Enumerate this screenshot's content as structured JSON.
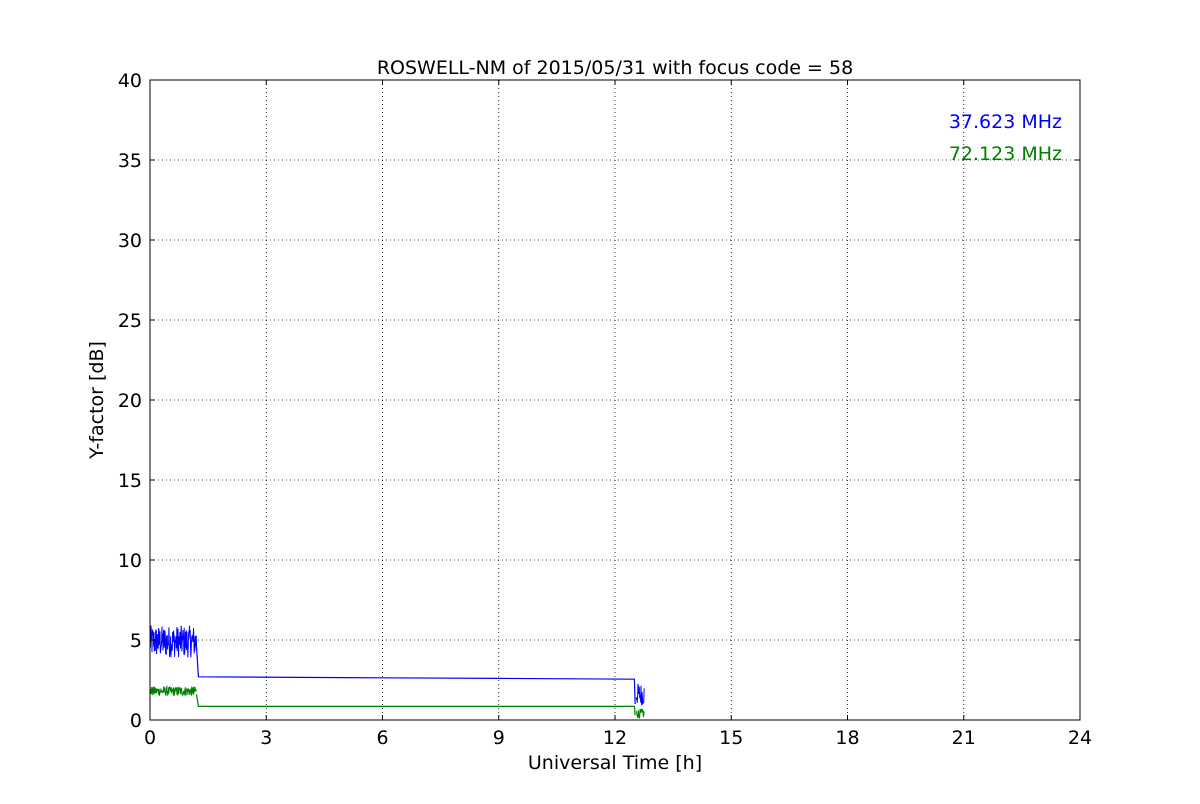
{
  "chart_data": {
    "type": "line",
    "title": "ROSWELL-NM of 2015/05/31 with focus code = 58",
    "xlabel": "Universal Time [h]",
    "ylabel": "Y-factor [dB]",
    "xlim": [
      0,
      24
    ],
    "ylim": [
      0,
      40
    ],
    "xticks": [
      0,
      3,
      6,
      9,
      12,
      15,
      18,
      21,
      24
    ],
    "yticks": [
      0,
      5,
      10,
      15,
      20,
      25,
      30,
      35,
      40
    ],
    "grid": true,
    "legend_placement": "top-right",
    "series": [
      {
        "name": "37.623 MHz",
        "color": "#0000ff",
        "noisy_segments": [
          {
            "x_start": 0.0,
            "x_end": 1.2,
            "y_low": 3.9,
            "y_high": 5.9
          },
          {
            "x_start": 12.55,
            "x_end": 12.75,
            "y_low": 0.9,
            "y_high": 2.3
          }
        ],
        "points": [
          [
            1.2,
            4.6
          ],
          [
            1.25,
            2.7
          ],
          [
            5.0,
            2.65
          ],
          [
            9.0,
            2.6
          ],
          [
            12.5,
            2.55
          ],
          [
            12.52,
            1.0
          ]
        ]
      },
      {
        "name": "72.123 MHz",
        "color": "#008000",
        "noisy_segments": [
          {
            "x_start": 0.0,
            "x_end": 1.2,
            "y_low": 1.5,
            "y_high": 2.1
          },
          {
            "x_start": 12.55,
            "x_end": 12.75,
            "y_low": 0.1,
            "y_high": 0.7
          }
        ],
        "points": [
          [
            1.2,
            1.6
          ],
          [
            1.25,
            0.85
          ],
          [
            5.0,
            0.85
          ],
          [
            9.0,
            0.85
          ],
          [
            12.5,
            0.85
          ],
          [
            12.52,
            0.3
          ]
        ]
      }
    ]
  }
}
